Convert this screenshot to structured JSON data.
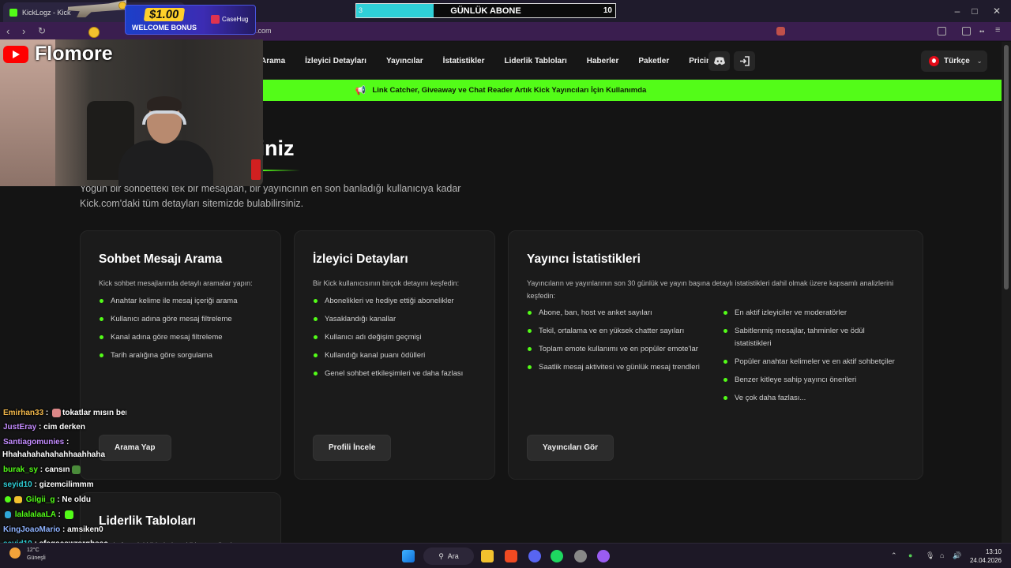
{
  "browser": {
    "tab_title": "KickLogz - Kick",
    "url": "kicklogz.com",
    "nav_back": "‹",
    "nav_forward": "›",
    "nav_reload": "↻",
    "minimize": "–",
    "maximize": "□",
    "close": "✕"
  },
  "overlay": {
    "sub_goal": {
      "title": "GÜNLÜK ABONE",
      "current": "3",
      "target": "10",
      "progress": 0.3
    },
    "promo": {
      "amount": "$1.00",
      "subtitle": "WELCOME BONUS",
      "brand": "CaseHug"
    },
    "channel_name": "Flomore"
  },
  "site": {
    "nav": [
      "Arama",
      "İzleyici Detayları",
      "Yayıncılar",
      "İstatistikler",
      "Liderlik Tabloları",
      "Haberler",
      "Paketler",
      "Pricing"
    ],
    "language": "Türkçe",
    "announcement": "Link Catcher, Giveaway ve Chat Reader Artık Kick Yayıncıları İçin Kullanımda",
    "hero_title_visible": "liniz",
    "hero_desc": "Yoğun bir sohbetteki tek bir mesajdan, bir yayıncının en son banladığı kullanıcıya kadar Kick.com'daki tüm detayları sitemizde bulabilirsiniz."
  },
  "cards": [
    {
      "title": "Sohbet Mesajı Arama",
      "subtitle": "Kick sohbet mesajlarında detaylı aramalar yapın:",
      "items": [
        "Anahtar kelime ile mesaj içeriği arama",
        "Kullanıcı adına göre mesaj filtreleme",
        "Kanal adına göre mesaj filtreleme",
        "Tarih aralığına göre sorgulama"
      ],
      "button": "Arama Yap"
    },
    {
      "title": "İzleyici Detayları",
      "subtitle": "Bir Kick kullanıcısının birçok detayını keşfedin:",
      "items": [
        "Abonelikleri ve hediye ettiği abonelikler",
        "Yasaklandığı kanallar",
        "Kullanıcı adı değişim geçmişi",
        "Kullandığı kanal puanı ödülleri",
        "Genel sohbet etkileşimleri ve daha fazlası"
      ],
      "button": "Profili İncele"
    },
    {
      "title": "Yayıncı İstatistikleri",
      "subtitle": "Yayıncıların ve yayınlarının son 30 günlük ve yayın başına detaylı istatistikleri dahil olmak üzere kapsamlı analizlerini keşfedin:",
      "items_left": [
        "Abone, ban, host ve anket sayıları",
        "Tekil, ortalama ve en yüksek chatter sayıları",
        "Toplam emote kullanımı ve en popüler emote'lar",
        "Saatlik mesaj aktivitesi ve günlük mesaj trendleri"
      ],
      "items_right": [
        "En aktif izleyiciler ve moderatörler",
        "Sabitlenmiş mesajlar, tahminler ve ödül istatistikleri",
        "Popüler anahtar kelimeler ve en aktif sohbetçiler",
        "Benzer kitleye sahip yayıncı önerileri",
        "Ve çok daha fazlası..."
      ],
      "button": "Yayıncıları Gör"
    },
    {
      "title": "Liderlik Tabloları",
      "subtitle": "Bu platformdaki liderleri çeşitli kategorilerde"
    }
  ],
  "chat": [
    {
      "user": "Emirhan33",
      "msg": "tokatlar mısın beni",
      "color": "#f2b84b"
    },
    {
      "user": "JustEray",
      "msg": "cim derken",
      "color": "#c48cff"
    },
    {
      "user": "Santiagomunies",
      "msg": "",
      "color": "#c48cff"
    },
    {
      "user": "",
      "msg": "Hhahahahahahahhaahhaha",
      "color": "#ffffff"
    },
    {
      "user": "burak_sy",
      "msg": "cansın",
      "color": "#53fc18"
    },
    {
      "user": "seyid10",
      "msg": "gizemcilimmm",
      "color": "#2fd0d8"
    },
    {
      "user": "Gilgii_g",
      "msg": "Ne oldu",
      "color": "#53fc18"
    },
    {
      "user": "lalalalaaLA",
      "msg": "",
      "color": "#53fc18"
    },
    {
      "user": "KingJoaoMario",
      "msg": "amsiken0",
      "color": "#8fb3ff"
    },
    {
      "user": "seyid10",
      "msg": "sfegseswrşrghsşç",
      "color": "#2fd0d8"
    }
  ],
  "taskbar": {
    "temp": "12°C",
    "weather": "Güneşli",
    "search": "Ara",
    "time": "13:10",
    "date": "24.04.2026"
  }
}
